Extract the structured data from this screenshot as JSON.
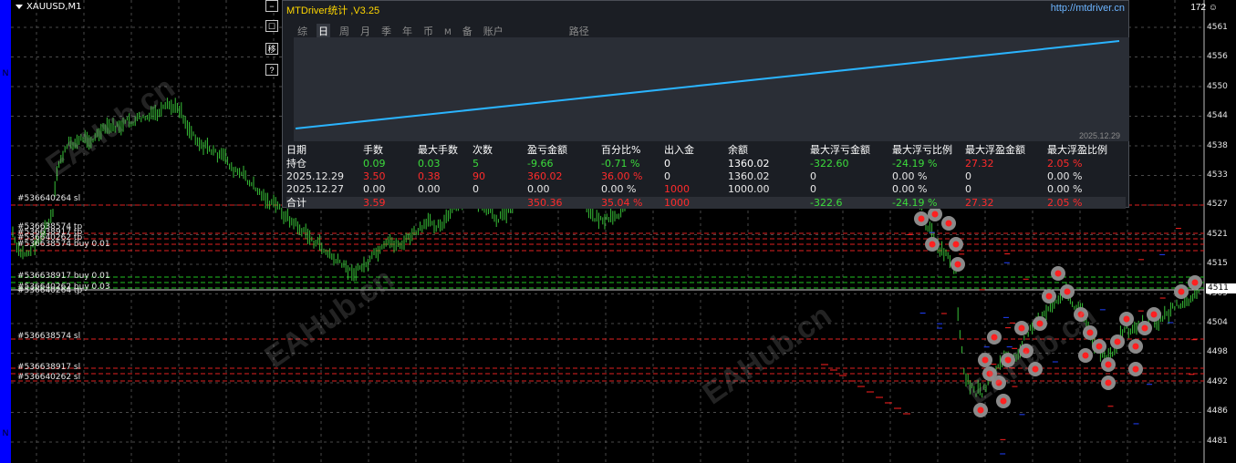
{
  "chart": {
    "symbol": "XAUUSD,M1",
    "corner_info": "172",
    "price_labels": [
      "4561",
      "4556",
      "4550",
      "4544",
      "4538",
      "4533",
      "4527",
      "4521",
      "4515",
      "4509",
      "4504",
      "4498",
      "4492",
      "4486",
      "4481"
    ],
    "current_price": "4511",
    "side_buttons": [
      "−",
      "☐",
      "移",
      "↗",
      "?"
    ],
    "order_labels": [
      "#536640264 sl",
      "#536638574 tp",
      "#536638917 tp",
      "#536640262 tp",
      "#536638574 buy 0.01",
      "#536638917 buy 0.01",
      "#536640262 buy 0.03",
      "#536640264 tp",
      "#536638574 sl",
      "#536638917 sl",
      "#536640262 sl"
    ],
    "watermark": "EAHub.cn",
    "colors": {
      "candle": "#38c038",
      "sl_line": "#e02020",
      "tp_line": "#20c020",
      "equity": "#2ab4ff",
      "background": "#000000"
    }
  },
  "panel": {
    "title": "MTDriver统计 ,V3.25",
    "url": "http://mtdriver.cn",
    "tabs": [
      {
        "label": "综",
        "active": false
      },
      {
        "label": "日",
        "active": true
      },
      {
        "label": "周",
        "active": false
      },
      {
        "label": "月",
        "active": false
      },
      {
        "label": "季",
        "active": false
      },
      {
        "label": "年",
        "active": false
      },
      {
        "label": "币",
        "active": false
      },
      {
        "label": "M",
        "active": false
      },
      {
        "label": "备",
        "active": false
      },
      {
        "label": "账户",
        "active": false
      },
      {
        "label": "路径",
        "active": false
      }
    ],
    "graph_date": "2025.12.29",
    "columns": [
      "日期",
      "手数",
      "最大手数",
      "次数",
      "盈亏金额",
      "百分比%",
      "出入金",
      "余额",
      "最大浮亏金额",
      "最大浮亏比例",
      "最大浮盈金额",
      "最大浮盈比例"
    ],
    "rows": [
      {
        "cells": [
          "持仓",
          "0.09",
          "0.03",
          "5",
          "-9.66",
          "-0.71 %",
          "0",
          "1360.02",
          "-322.60",
          "-24.19 %",
          "27.32",
          "2.05 %"
        ],
        "colors": [
          "w",
          "g",
          "g",
          "g",
          "g",
          "g",
          "w",
          "w",
          "g",
          "g",
          "r",
          "r"
        ]
      },
      {
        "cells": [
          "2025.12.29",
          "3.50",
          "0.38",
          "90",
          "360.02",
          "36.00 %",
          "0",
          "1360.02",
          "0",
          "0.00 %",
          "0",
          "0.00 %"
        ],
        "colors": [
          "h",
          "r",
          "r",
          "r",
          "r",
          "r",
          "h",
          "h",
          "h",
          "h",
          "h",
          "h"
        ]
      },
      {
        "cells": [
          "2025.12.27",
          "0.00",
          "0.00",
          "0",
          "0.00",
          "0.00 %",
          "1000",
          "1000.00",
          "0",
          "0.00 %",
          "0",
          "0.00 %"
        ],
        "colors": [
          "h",
          "h",
          "h",
          "h",
          "h",
          "h",
          "r",
          "h",
          "h",
          "h",
          "h",
          "h"
        ]
      },
      {
        "cells": [
          "合计",
          "3.59",
          "",
          "",
          "350.36",
          "35.04 %",
          "1000",
          "",
          "-322.6",
          "-24.19 %",
          "27.32",
          "2.05 %"
        ],
        "colors": [
          "w",
          "r",
          "r",
          "r",
          "r",
          "r",
          "r",
          "w",
          "g",
          "g",
          "r",
          "r"
        ]
      }
    ]
  }
}
